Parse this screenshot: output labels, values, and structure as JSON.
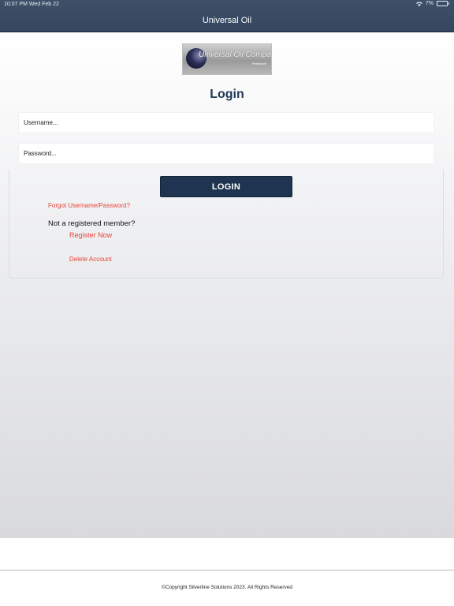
{
  "status_bar": {
    "time_date": "10:07 PM   Wed Feb 22",
    "battery": "7%"
  },
  "header": {
    "title": "Universal Oil"
  },
  "logo": {
    "name": "Universal Oil Company",
    "tagline": "Petroleum"
  },
  "login": {
    "heading": "Login",
    "username_placeholder": "Username...",
    "password_placeholder": "Password...",
    "button_label": "LOGIN",
    "forgot_link": "Forgot Username/Password?",
    "not_registered_text": "Not a registered member?",
    "register_link": "Register Now",
    "delete_link": "Delete Account"
  },
  "footer": {
    "copyright": "©Copyright Silverline Solutions 2023. All Rights Reserved"
  },
  "colors": {
    "header_bg": "#3a4d65",
    "button_bg": "#1e3450",
    "heading": "#1d3856",
    "link": "#e8433a"
  }
}
